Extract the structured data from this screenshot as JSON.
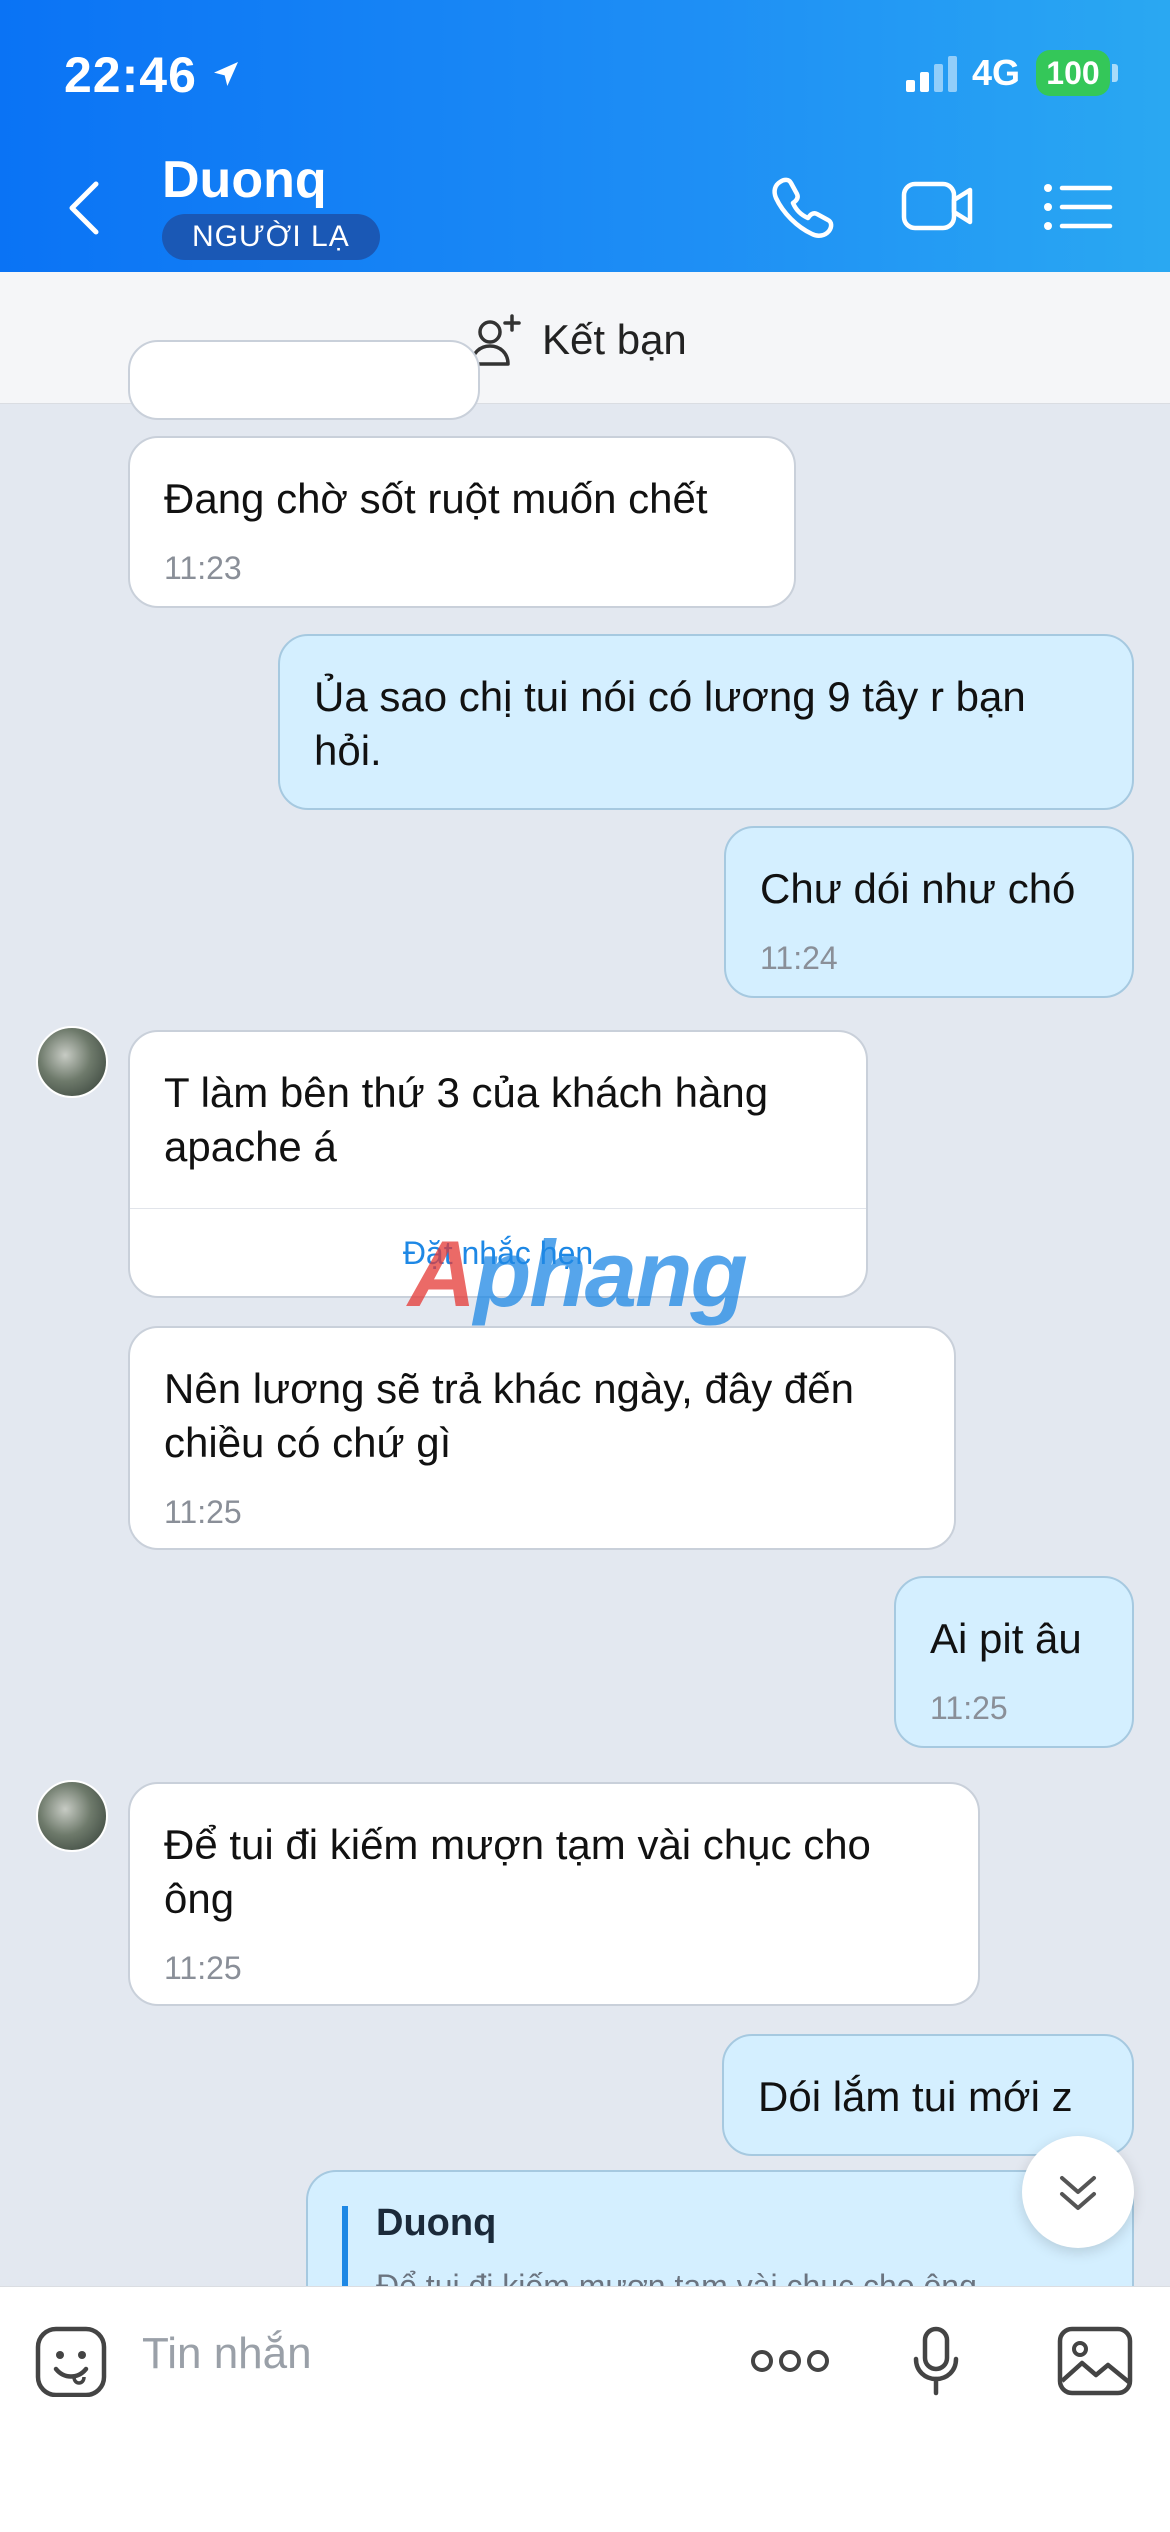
{
  "status_bar": {
    "time": "22:46",
    "network": "4G",
    "battery": "100"
  },
  "header": {
    "contact_name": "Duonq",
    "badge": "NGƯỜI LẠ"
  },
  "add_friend": {
    "label": "Kết bạn"
  },
  "messages": [
    {
      "side": "in",
      "text": "Đang chờ sốt ruột muốn chết",
      "time": "11:23"
    },
    {
      "side": "out",
      "text": "Ủa sao chị tui nói có lương 9 tây r bạn hỏi.",
      "time": ""
    },
    {
      "side": "out",
      "text": "Chư dói như chó",
      "time": "11:24"
    },
    {
      "side": "in",
      "text": "T làm bên thứ 3 của khách hàng apache á",
      "action": "Đặt nhắc hẹn"
    },
    {
      "side": "in",
      "text": "Nên lương sẽ trả khác ngày, đây đến chiều có chứ gì",
      "time": "11:25"
    },
    {
      "side": "out",
      "text": "Ai pit âu",
      "time": "11:25"
    },
    {
      "side": "in",
      "text": "Để tui đi kiếm mượn tạm vài chục cho ông",
      "time": "11:25"
    },
    {
      "side": "out",
      "text": "Dói lắm tui mới z",
      "time": ""
    }
  ],
  "quoted_reply": {
    "name": "Duonq",
    "text": "Để tui đi kiếm mượn tạm vài chục cho ông"
  },
  "watermark": {
    "first": "A",
    "rest": "phang"
  },
  "composer": {
    "placeholder": "Tin nhắn"
  },
  "colors": {
    "header_start": "#0a73f5",
    "header_end": "#2aa8f2",
    "outgoing_bubble": "#d4efff",
    "incoming_bubble": "#ffffff",
    "chat_bg": "#e3e8f0",
    "badge_bg": "#1a58b5"
  }
}
